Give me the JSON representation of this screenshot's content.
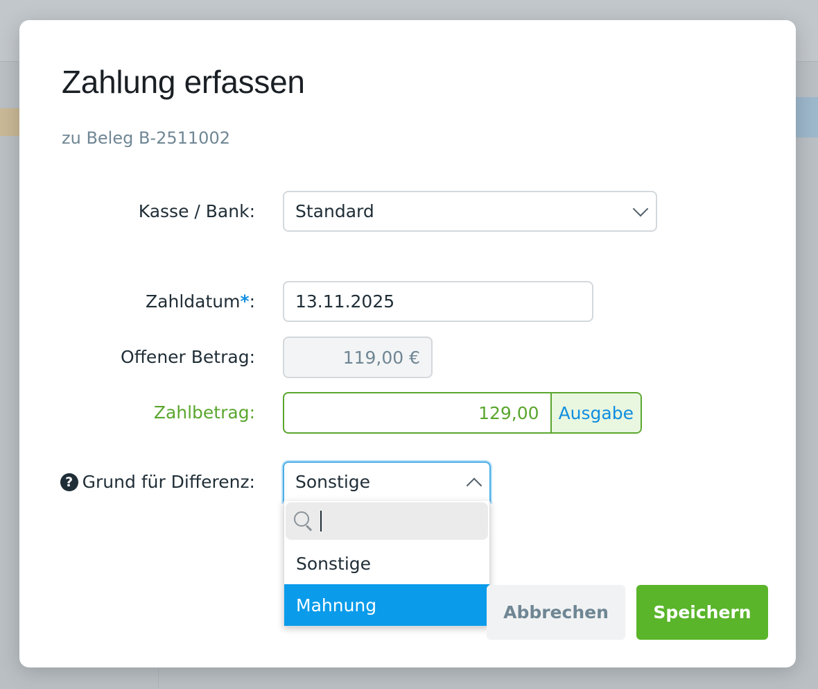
{
  "dialog": {
    "title": "Zahlung erfassen",
    "subtitle": "zu Beleg B-2511002"
  },
  "form": {
    "account": {
      "label": "Kasse / Bank:",
      "value": "Standard"
    },
    "payment_date": {
      "label": "Zahldatum",
      "required_mark": "*",
      "label_suffix": ":",
      "value": "13.11.2025"
    },
    "open_amount": {
      "label": "Offener Betrag:",
      "value": "119,00 €"
    },
    "payment_amount": {
      "label": "Zahlbetrag:",
      "value": "129,00",
      "suffix": "Ausgabe"
    },
    "difference_reason": {
      "label": "Grund für Differenz:",
      "help_icon": "?",
      "value": "Sonstige",
      "search_value": "",
      "options": [
        "Sonstige",
        "Mahnung"
      ],
      "highlighted_option": "Mahnung"
    }
  },
  "buttons": {
    "cancel": "Abbrechen",
    "save": "Speichern"
  },
  "colors": {
    "accent_blue": "#0a9bea",
    "success_green": "#5ab52a",
    "amount_green": "#5aa62e",
    "muted_text": "#6f8694"
  },
  "icons": [
    "chevron-down-icon",
    "chevron-up-icon",
    "help-icon",
    "search-icon"
  ]
}
